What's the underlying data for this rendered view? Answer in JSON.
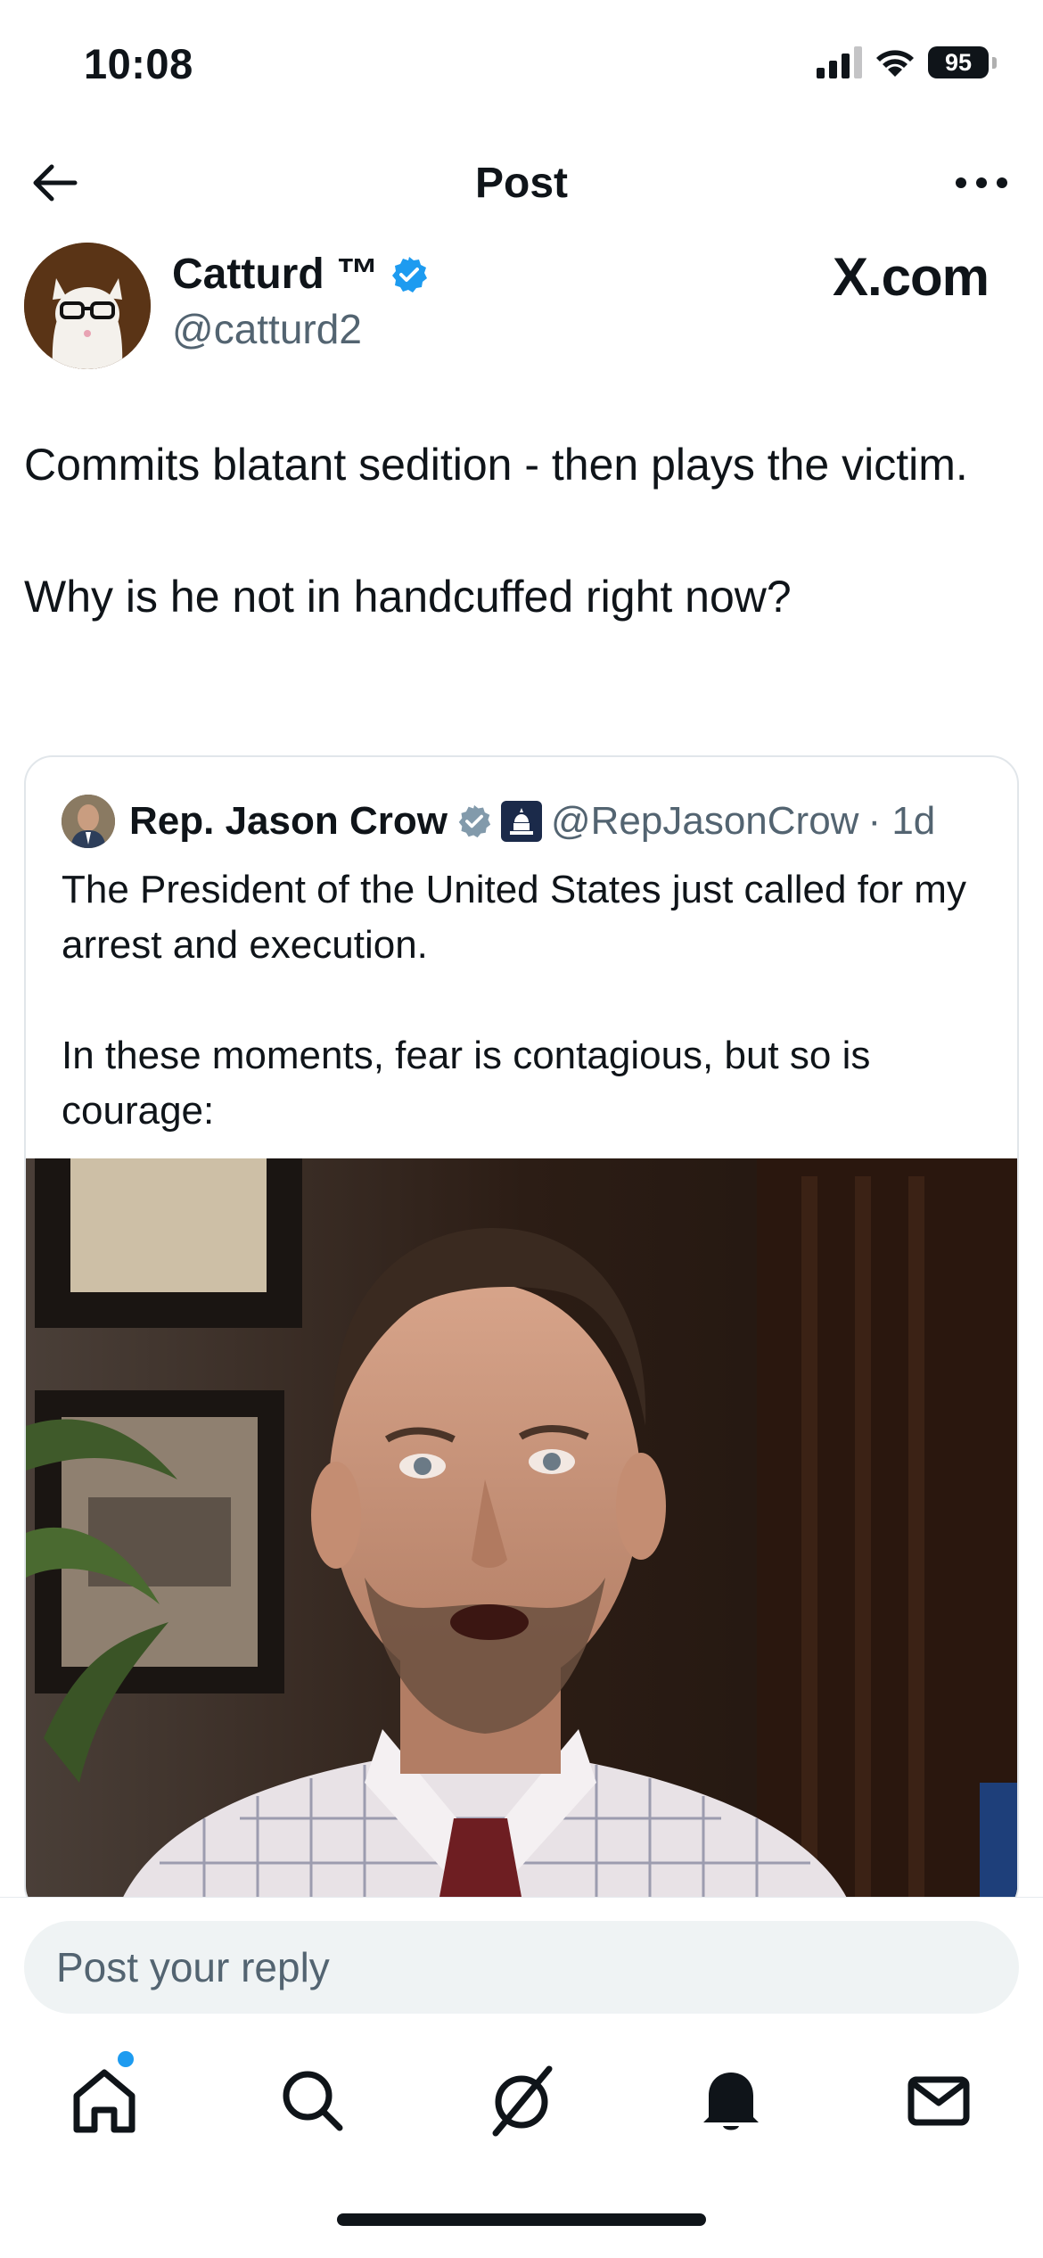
{
  "status_bar": {
    "time": "10:08",
    "battery": "95"
  },
  "header": {
    "title": "Post"
  },
  "author": {
    "name": "Catturd ™",
    "handle": "@catturd2",
    "source_label": "X.com"
  },
  "post": {
    "text": "Commits blatant sedition - then plays the victim.\n\nWhy is he not in handcuffed right now?"
  },
  "quoted_post": {
    "name": "Rep. Jason Crow",
    "handle": "@RepJasonCrow",
    "time": "· 1d",
    "text": "The President of the United States just called for my arrest and execution.\n\nIn these moments, fear is contagious, but so is courage:"
  },
  "reply": {
    "placeholder": "Post your reply"
  },
  "tabs": [
    {
      "icon": "home-icon",
      "has_notification": true
    },
    {
      "icon": "search-icon"
    },
    {
      "icon": "grok-icon"
    },
    {
      "icon": "bell-icon"
    },
    {
      "icon": "mail-icon"
    }
  ],
  "colors": {
    "accent": "#1d9bf0",
    "verified_blue": "#1d9bf0",
    "verified_gray": "#829aab",
    "secondary_text": "#536471"
  }
}
